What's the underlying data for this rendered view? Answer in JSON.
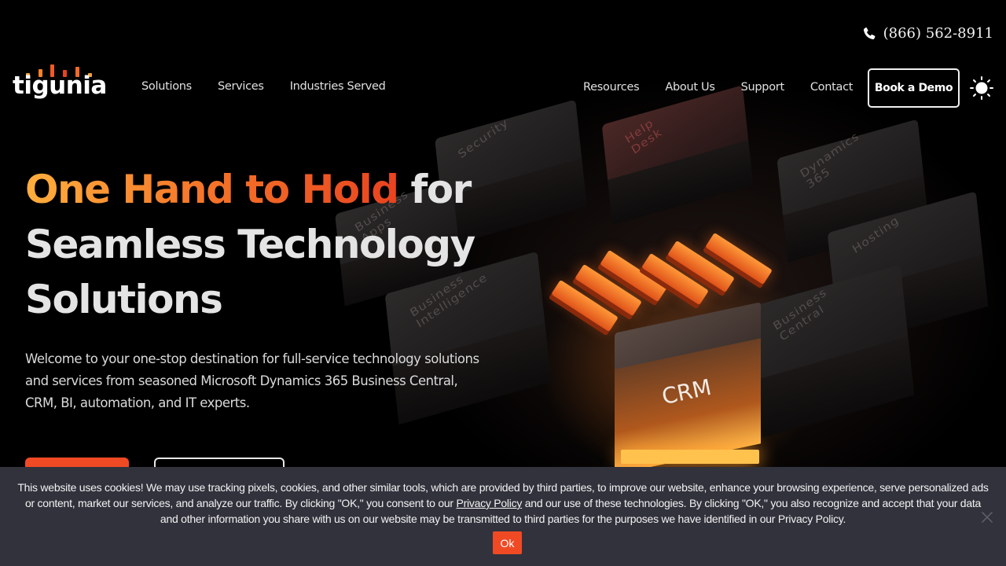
{
  "header": {
    "phone": {
      "icon": "phone-icon",
      "number": "(866) 562-8911"
    },
    "logo": {
      "text": "tigunia",
      "icon": "signal-bars-icon",
      "brand_color": "#f26a2a"
    },
    "nav_left": [
      {
        "label": "Solutions"
      },
      {
        "label": "Services"
      },
      {
        "label": "Industries Served"
      }
    ],
    "nav_right": [
      {
        "label": "Resources"
      },
      {
        "label": "About Us"
      },
      {
        "label": "Support"
      },
      {
        "label": "Contact"
      }
    ],
    "book_demo_label": "Book a Demo",
    "theme_toggle_icon": "sun-icon"
  },
  "hero": {
    "headline_accent": "One Hand to Hold",
    "headline_rest_line1": " for",
    "headline_line2": "Seamless Technology",
    "headline_line3": "Solutions",
    "intro": "Welcome to your one-stop destination for full-service technology solutions and services from seasoned Microsoft Dynamics 365 Business Central, CRM, BI, automation, and IT experts.",
    "accent_gradient": [
      "#ffae3d",
      "#f5782a",
      "#e8431f"
    ],
    "image_labels": {
      "security": "Security",
      "help_desk": "Help\nDesk",
      "dynamics": "Dynamics\n365",
      "business_apps": "Business\nApps",
      "hosting": "Hosting",
      "business_intelligence": "Business\nIntelligence",
      "business_central": "Business\nCentral",
      "crm": "CRM"
    }
  },
  "cookie_banner": {
    "text_before_link": "This website uses cookies! We may use tracking pixels, cookies, and other similar tools, which are provided by third parties, to improve our website, enhance your browsing experience, serve personalized ads or content, market our services, and analyze our traffic. By clicking \"OK,\" you consent to our ",
    "link_label": "Privacy Policy",
    "text_after_link": " and our use of these technologies. By clicking \"OK,\" you also recognize and accept that your data and other information you share with us on our website may be transmitted to third parties for the purposes we have identified in our Privacy Policy.",
    "ok_label": "Ok",
    "close_icon": "close-icon",
    "background_color": "#32323d",
    "button_color": "#f04a25"
  }
}
